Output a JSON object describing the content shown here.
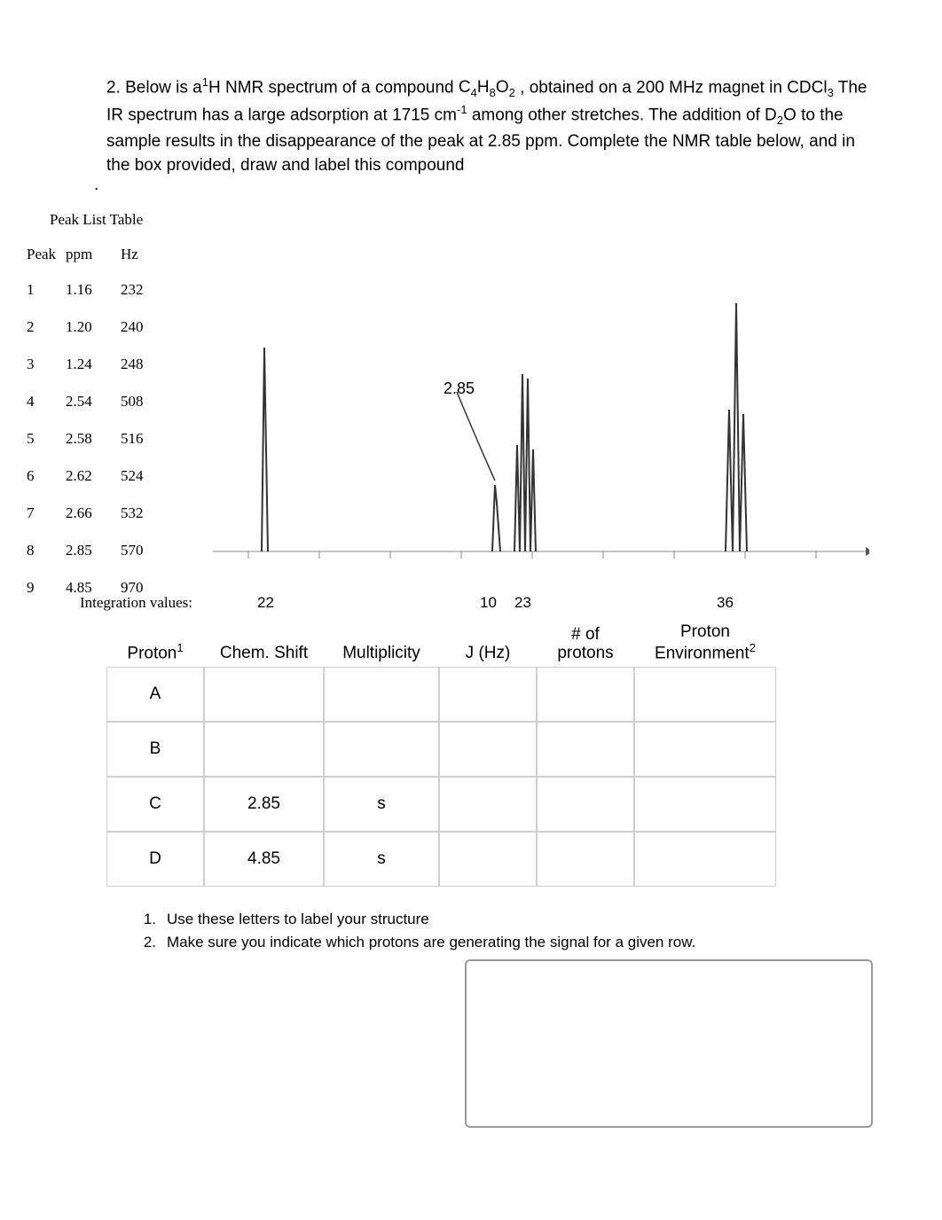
{
  "question": {
    "line1_prefix": "2. Below is a",
    "line1_sup1": "1",
    "line1_mid1": "H NMR spectrum of a compound",
    "line1_formula_c": "C",
    "line1_formula_4": "4",
    "line1_formula_h": "H",
    "line1_formula_8": "8",
    "line1_formula_o": "O",
    "line1_formula_2": "2",
    "line1_mid2": " , obtained on a 200 MHz magnet in CDCl",
    "line1_sub3": "3",
    "line2a": "The IR spectrum has a large adsorption at 1715 cm",
    "line2_sup": "-1",
    "line2b": " among other stretches. The addition of D",
    "line2_sub2": "2",
    "line2c": "O to the",
    "line3": "sample results in the disappearance of the peak at 2.85 ppm. Complete the NMR table below, and in the",
    "line4": "box provided, draw and label this compound",
    "dot": "."
  },
  "peakTable": {
    "title": "Peak List Table",
    "headers": {
      "c1": "Peak",
      "c2": "ppm",
      "c3": "Hz"
    },
    "rows": [
      {
        "n": "1",
        "ppm": "1.16",
        "hz": "232"
      },
      {
        "n": "2",
        "ppm": "1.20",
        "hz": "240"
      },
      {
        "n": "3",
        "ppm": "1.24",
        "hz": "248"
      },
      {
        "n": "4",
        "ppm": "2.54",
        "hz": "508"
      },
      {
        "n": "5",
        "ppm": "2.58",
        "hz": "516"
      },
      {
        "n": "6",
        "ppm": "2.62",
        "hz": "524"
      },
      {
        "n": "7",
        "ppm": "2.66",
        "hz": "532"
      },
      {
        "n": "8",
        "ppm": "2.85",
        "hz": "570"
      },
      {
        "n": "9",
        "ppm": "4.85",
        "hz": "970"
      }
    ]
  },
  "spectrum": {
    "annotation": "2.85"
  },
  "integration": {
    "label": "Integration values:",
    "v1": "22",
    "v2": "10",
    "v3": "23",
    "v4": "36"
  },
  "analysis": {
    "headers": {
      "proton": "Proton",
      "proton_sup": "1",
      "shift": "Chem. Shift",
      "mult": "Multiplicity",
      "j": "J (Hz)",
      "nprot_l1": "# of",
      "nprot_l2": "protons",
      "env_l1": "Proton",
      "env_l2": "Environment",
      "env_sup": "2"
    },
    "rows": [
      {
        "p": "A",
        "shift": "",
        "mult": "",
        "j": "",
        "n": "",
        "env": ""
      },
      {
        "p": "B",
        "shift": "",
        "mult": "",
        "j": "",
        "n": "",
        "env": ""
      },
      {
        "p": "C",
        "shift": "2.85",
        "mult": "s",
        "j": "",
        "n": "",
        "env": ""
      },
      {
        "p": "D",
        "shift": "4.85",
        "mult": "s",
        "j": "",
        "n": "",
        "env": ""
      }
    ]
  },
  "notes": {
    "n1_num": "1.",
    "n1_text": "Use these letters to label your structure",
    "n2_num": "2.",
    "n2_text": "Make sure you indicate which protons are generating the signal for a given row."
  }
}
